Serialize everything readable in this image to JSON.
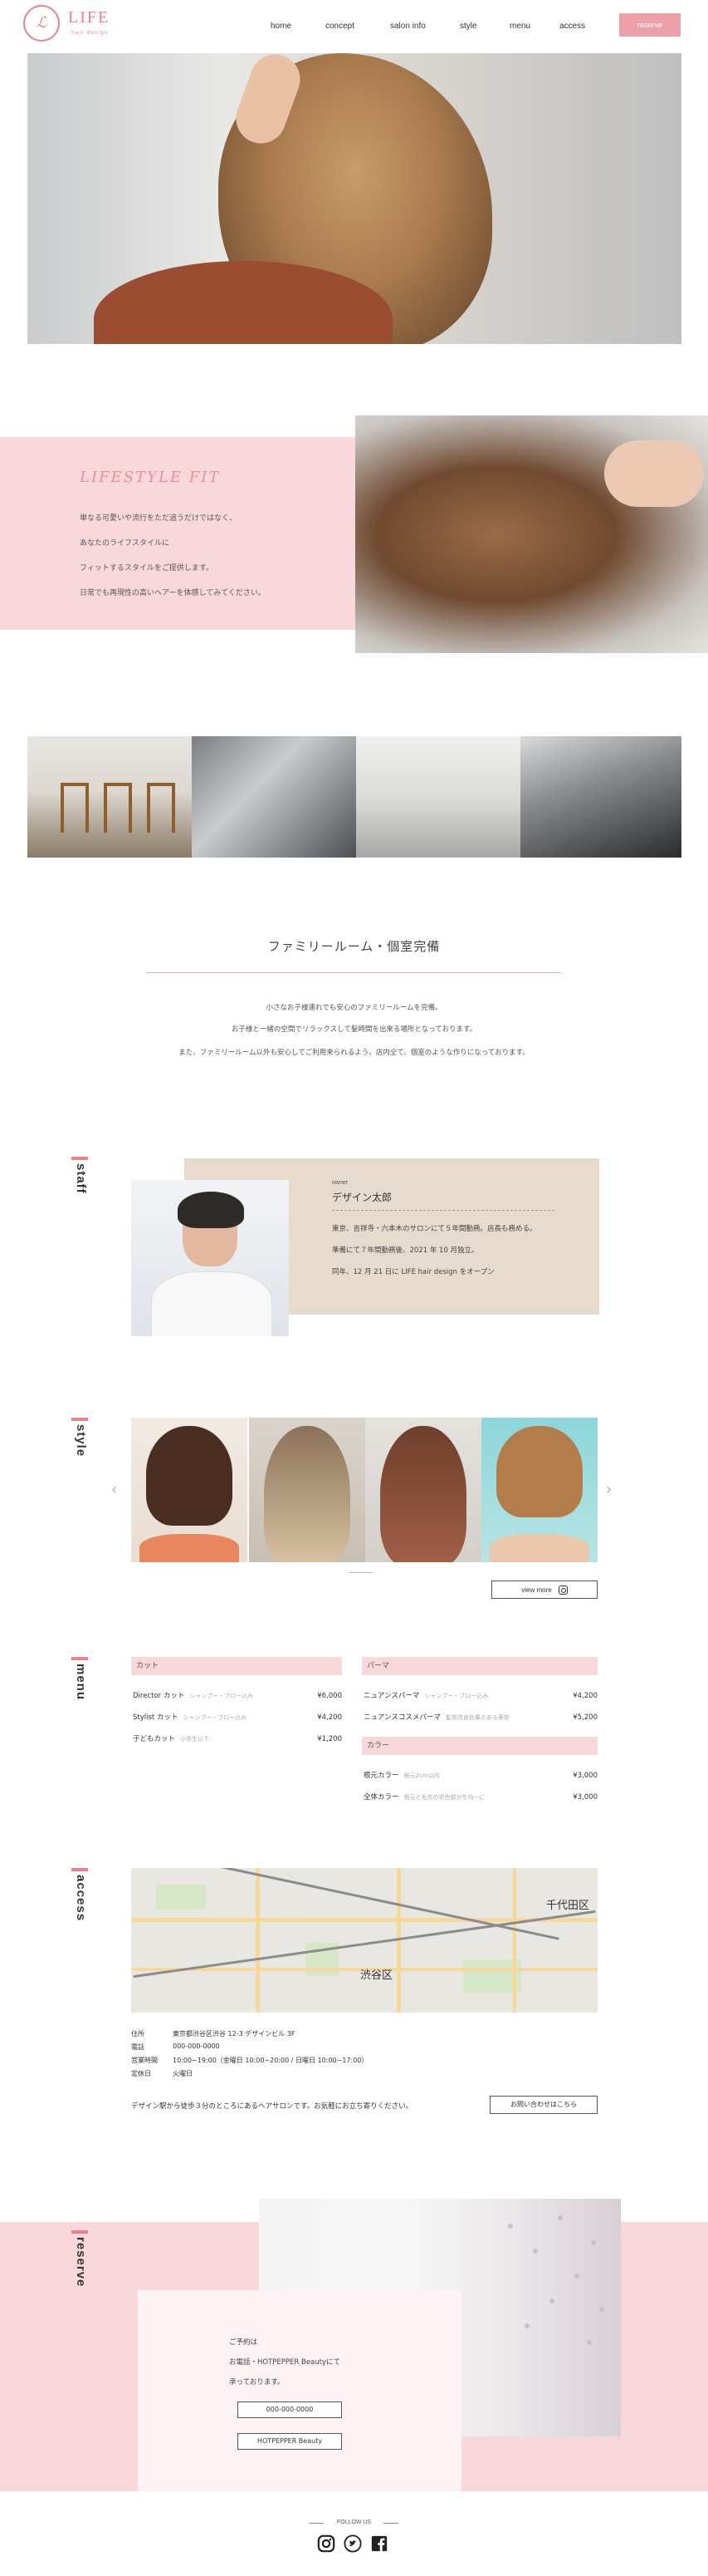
{
  "header": {
    "logo_text": "LIFE",
    "logo_sub": "hair design",
    "nav": [
      "home",
      "concept",
      "salon info",
      "style",
      "menu",
      "access"
    ],
    "reserve_label": "reserve"
  },
  "lifestyle": {
    "title": "LIFESTYLE FIT",
    "lines": [
      "単なる可愛いや流行をただ追うだけではなく、",
      "あなたのライフスタイルに",
      "フィットするスタイルをご提供します。",
      "日常でも再現性の高いヘアーを体感してみてください。"
    ]
  },
  "family": {
    "title": "ファミリールーム・個室完備",
    "lines": [
      "小さなお子様連れでも安心のファミリールームを完備。",
      "お子様と一緒の空間でリラックスして髪時間を出来る場所となっております。",
      "また、ファミリールーム以外も安心してご利用来られるよう、店内全て、個室のような作りになっております。"
    ]
  },
  "staff": {
    "label": "staff",
    "role": "owner",
    "name": "デザイン太郎",
    "lines": [
      "東京、吉祥寺・六本木のサロンにて５年間勤務。店長も務める。",
      "準備にて７年間勤務後、2021 年 10 月独立。",
      "同年、12 月 21 日に LIFE hair design をオープン"
    ]
  },
  "style": {
    "label": "style",
    "prev_arrow": "‹",
    "next_arrow": "›",
    "view_more": "view more"
  },
  "menu": {
    "label": "menu",
    "cut": {
      "title": "カット",
      "items": [
        {
          "name": "Director カット",
          "desc": "シャンプー・ブロー込み",
          "price": "¥6,000"
        },
        {
          "name": "Stylist カット",
          "desc": "シャンプー・ブロー込み",
          "price": "¥4,200"
        },
        {
          "name": "子どもカット",
          "desc": "小学生以下",
          "price": "¥1,200"
        }
      ]
    },
    "perm": {
      "title": "パーマ",
      "items": [
        {
          "name": "ニュアンスパーマ",
          "desc": "シャンプー・ブロー込み",
          "price": "¥4,200"
        },
        {
          "name": "ニュアンスコスメパーマ",
          "desc": "髪質改善効果のある薬剤",
          "price": "¥5,200"
        }
      ]
    },
    "color": {
      "title": "カラー",
      "items": [
        {
          "name": "根元カラー",
          "desc": "根元2cm以内",
          "price": "¥3,000"
        },
        {
          "name": "全体カラー",
          "desc": "根元と毛先の退色部分を均一に",
          "price": "¥3,000"
        }
      ]
    }
  },
  "access": {
    "label": "access",
    "map_labels": [
      "千代田区",
      "渋谷区"
    ],
    "info": [
      {
        "key": "住所",
        "value": "東京都渋谷区渋谷 12-3 デザインビル 3F"
      },
      {
        "key": "電話",
        "value": "000-000-0000"
      },
      {
        "key": "営業時間",
        "value": "10:00~19:00（金曜日 10:00~20:00 / 日曜日 10:00~17:00）"
      },
      {
        "key": "定休日",
        "value": "火曜日"
      }
    ],
    "note": "デザイン駅から徒歩３分のところにあるヘアサロンです。お気軽にお立ち寄りください。",
    "contact_label": "お問い合わせはこちら"
  },
  "reserve": {
    "label": "reserve",
    "lines": [
      "ご予約は",
      "お電話・HOTPEPPER Beautyにて",
      "承っております。"
    ],
    "phone_btn": "000-000-0000",
    "hotpepper_btn": "HOTPEPPER Beauty"
  },
  "footer": {
    "follow": "FOLLOW US",
    "social_icons": [
      "instagram-icon",
      "twitter-icon",
      "facebook-icon"
    ]
  },
  "colors": {
    "accent": "#e6848b",
    "pink_bg": "#f9d8dc",
    "beige_bg": "#e7dbcd"
  }
}
